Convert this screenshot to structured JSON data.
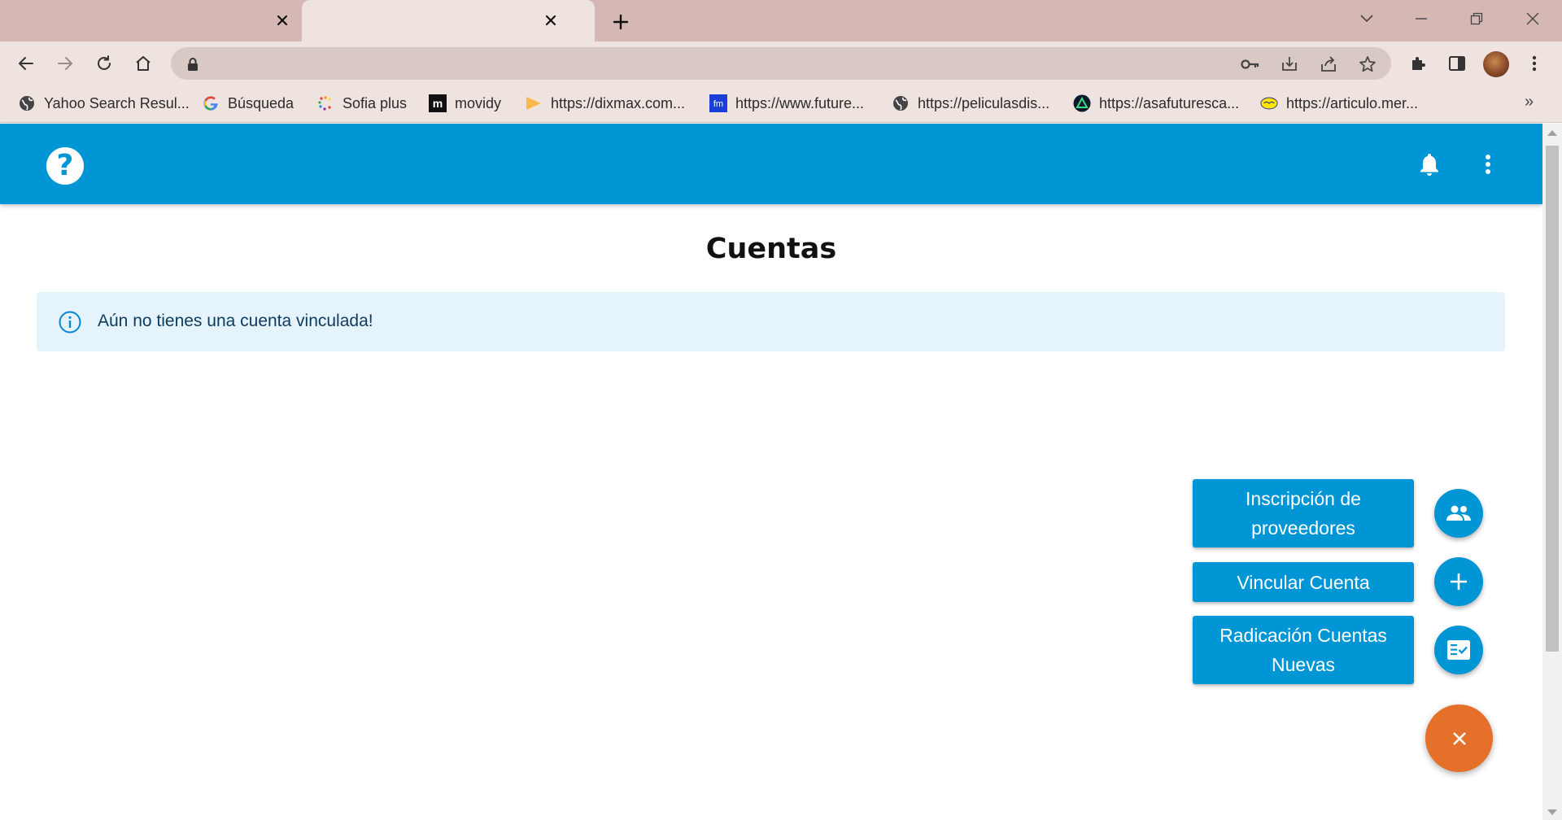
{
  "browser": {
    "address_url": "",
    "bookmarks": [
      {
        "label": "Yahoo Search Resul...",
        "icon": "globe-icon"
      },
      {
        "label": "Búsqueda",
        "icon": "google-icon"
      },
      {
        "label": "Sofia plus",
        "icon": "sofia-icon"
      },
      {
        "label": "movidy",
        "icon": "movidy-icon"
      },
      {
        "label": "https://dixmax.com...",
        "icon": "dixmax-icon"
      },
      {
        "label": "https://www.future...",
        "icon": "fm-icon"
      },
      {
        "label": "https://peliculasdis...",
        "icon": "globe-icon"
      },
      {
        "label": "https://asafuturesca...",
        "icon": "triangle-icon"
      },
      {
        "label": "https://articulo.mer...",
        "icon": "mercadolibre-icon"
      }
    ],
    "more_bookmarks": "»"
  },
  "app": {
    "title": "Cuentas",
    "alert_text": "Aún no tienes una cuenta vinculada!",
    "speed_dial": [
      {
        "label": "Inscripción de proveedores",
        "icon": "group-icon"
      },
      {
        "label": "Vincular Cuenta",
        "icon": "plus-icon"
      },
      {
        "label": "Radicación Cuentas Nuevas",
        "icon": "fact-check-icon"
      }
    ],
    "colors": {
      "primary": "#0096d6",
      "accent": "#e5702a",
      "alert_bg": "#e5f3fc",
      "alert_text": "#0d3c61",
      "tab_strip": "#d5b8b3",
      "toolbar": "#efe3df"
    }
  }
}
